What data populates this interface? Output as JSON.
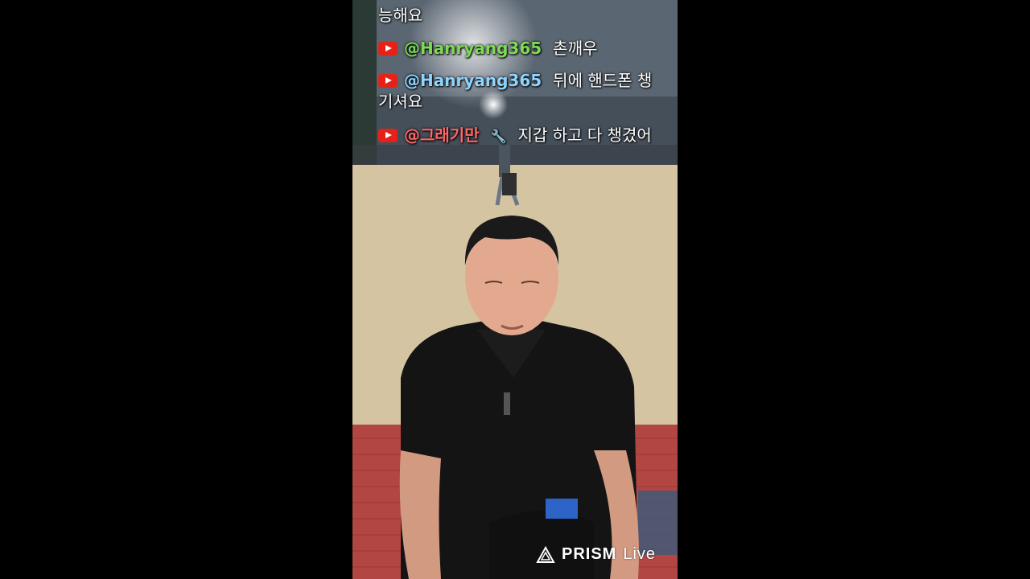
{
  "chat": [
    {
      "author": "",
      "text": "능해요",
      "icon": "youtube-icon"
    },
    {
      "author": "@Hanryang365",
      "text": "촌깨우",
      "icon": "youtube-icon"
    },
    {
      "author": "@Hanryang365",
      "text": "뒤에 핸드폰 챙기셔요",
      "icon": "youtube-icon"
    },
    {
      "author": "@그래기만",
      "text": "지갑 하고 다 챙겼어",
      "icon": "youtube-icon",
      "badge": "wrench-icon"
    }
  ],
  "watermark": {
    "brand": "PRISM",
    "live": "Live",
    "icon": "prism-triangle-icon"
  },
  "colors": {
    "youtube_red": "#e62117",
    "author_green": "#7ed957",
    "author_blue": "#8fd4ff",
    "author_red": "#ff6666"
  }
}
